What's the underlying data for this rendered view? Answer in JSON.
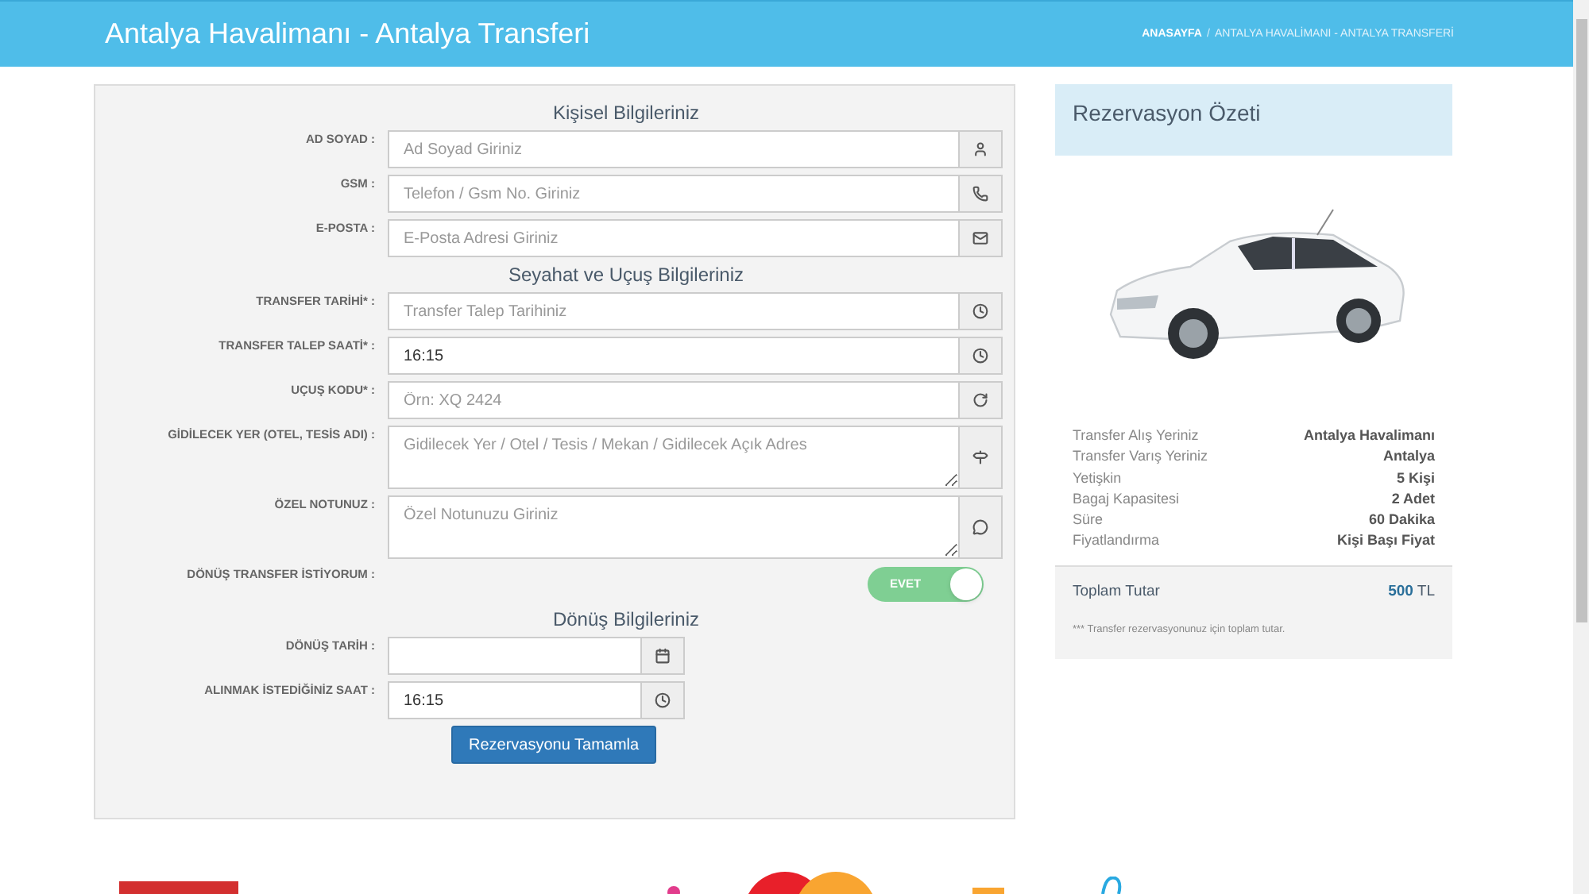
{
  "header": {
    "title": "Antalya Havalimanı - Antalya Transferi",
    "breadcrumb": [
      {
        "label": "ANASAYFA",
        "current": false
      },
      {
        "label": "ANTALYA HAVALİMANI - ANTALYA TRANSFERİ",
        "current": true
      }
    ],
    "separator": "/"
  },
  "sections": [
    {
      "title": "Kişisel Bilgileriniz",
      "fields": [
        {
          "label": "AD SOYAD :",
          "kind": "input",
          "placeholder": "Ad Soyad Giriniz"
        },
        {
          "label": "GSM :",
          "kind": "input",
          "placeholder": "Telefon / Gsm No. Giriniz"
        },
        {
          "label": "E-POSTA :",
          "kind": "input",
          "placeholder": "E-Posta Adresi Giriniz"
        }
      ]
    },
    {
      "title": "Seyahat ve Uçuş Bilgileriniz",
      "fields": [
        {
          "label": "TRANSFER TARİHİ* :",
          "kind": "input",
          "placeholder": "Transfer Talep Tarihiniz"
        },
        {
          "label": "TRANSFER TALEP SAATİ* :",
          "kind": "input",
          "value": "16:15"
        },
        {
          "label": "UÇUŞ KODU* :",
          "kind": "input",
          "placeholder": "Örn: XQ 2424"
        },
        {
          "label": "GİDİLECEK YER (OTEL, TESİS ADI) :",
          "kind": "textarea",
          "placeholder": "Gidilecek Yer / Otel / Tesis / Mekan / Gidilecek Açık Adres"
        },
        {
          "label": "ÖZEL NOTUNUZ :",
          "kind": "textarea",
          "placeholder": "Özel Notunuzu Giriniz"
        },
        {
          "label": "DÖNÜŞ TRANSFER İSTİYORUM :",
          "kind": "switch",
          "on": true,
          "text": "EVET"
        }
      ]
    },
    {
      "title": "Dönüş Bilgileriniz",
      "fields": [
        {
          "label": "DÖNÜŞ TARİH :",
          "kind": "short-input"
        },
        {
          "label": "ALINMAK İSTEDİĞİNİZ SAAT :",
          "kind": "short-input",
          "value": "16:15"
        }
      ]
    }
  ],
  "submit": "Rezervasyonu Tamamla",
  "summary": {
    "title": "Rezervasyon Özeti",
    "rows": [
      {
        "label": "Transfer Alış Yeriniz",
        "value": "Antalya Havalimanı"
      },
      {
        "label": "Transfer Varış Yeriniz",
        "value": "Antalya"
      },
      {
        "label": "Yetişkin",
        "value": "5 Kişi"
      },
      {
        "label": "Bagaj Kapasitesi",
        "value": "2 Adet"
      },
      {
        "label": "Süre",
        "value": "60 Dakika"
      },
      {
        "label": "Fiyatlandırma",
        "value": "Kişi Başı Fiyat"
      }
    ],
    "total": {
      "label": "Toplam Tutar",
      "amount": "500",
      "currency": "TL"
    },
    "note": "*** Transfer rezervasyonunuz için toplam tutar."
  }
}
